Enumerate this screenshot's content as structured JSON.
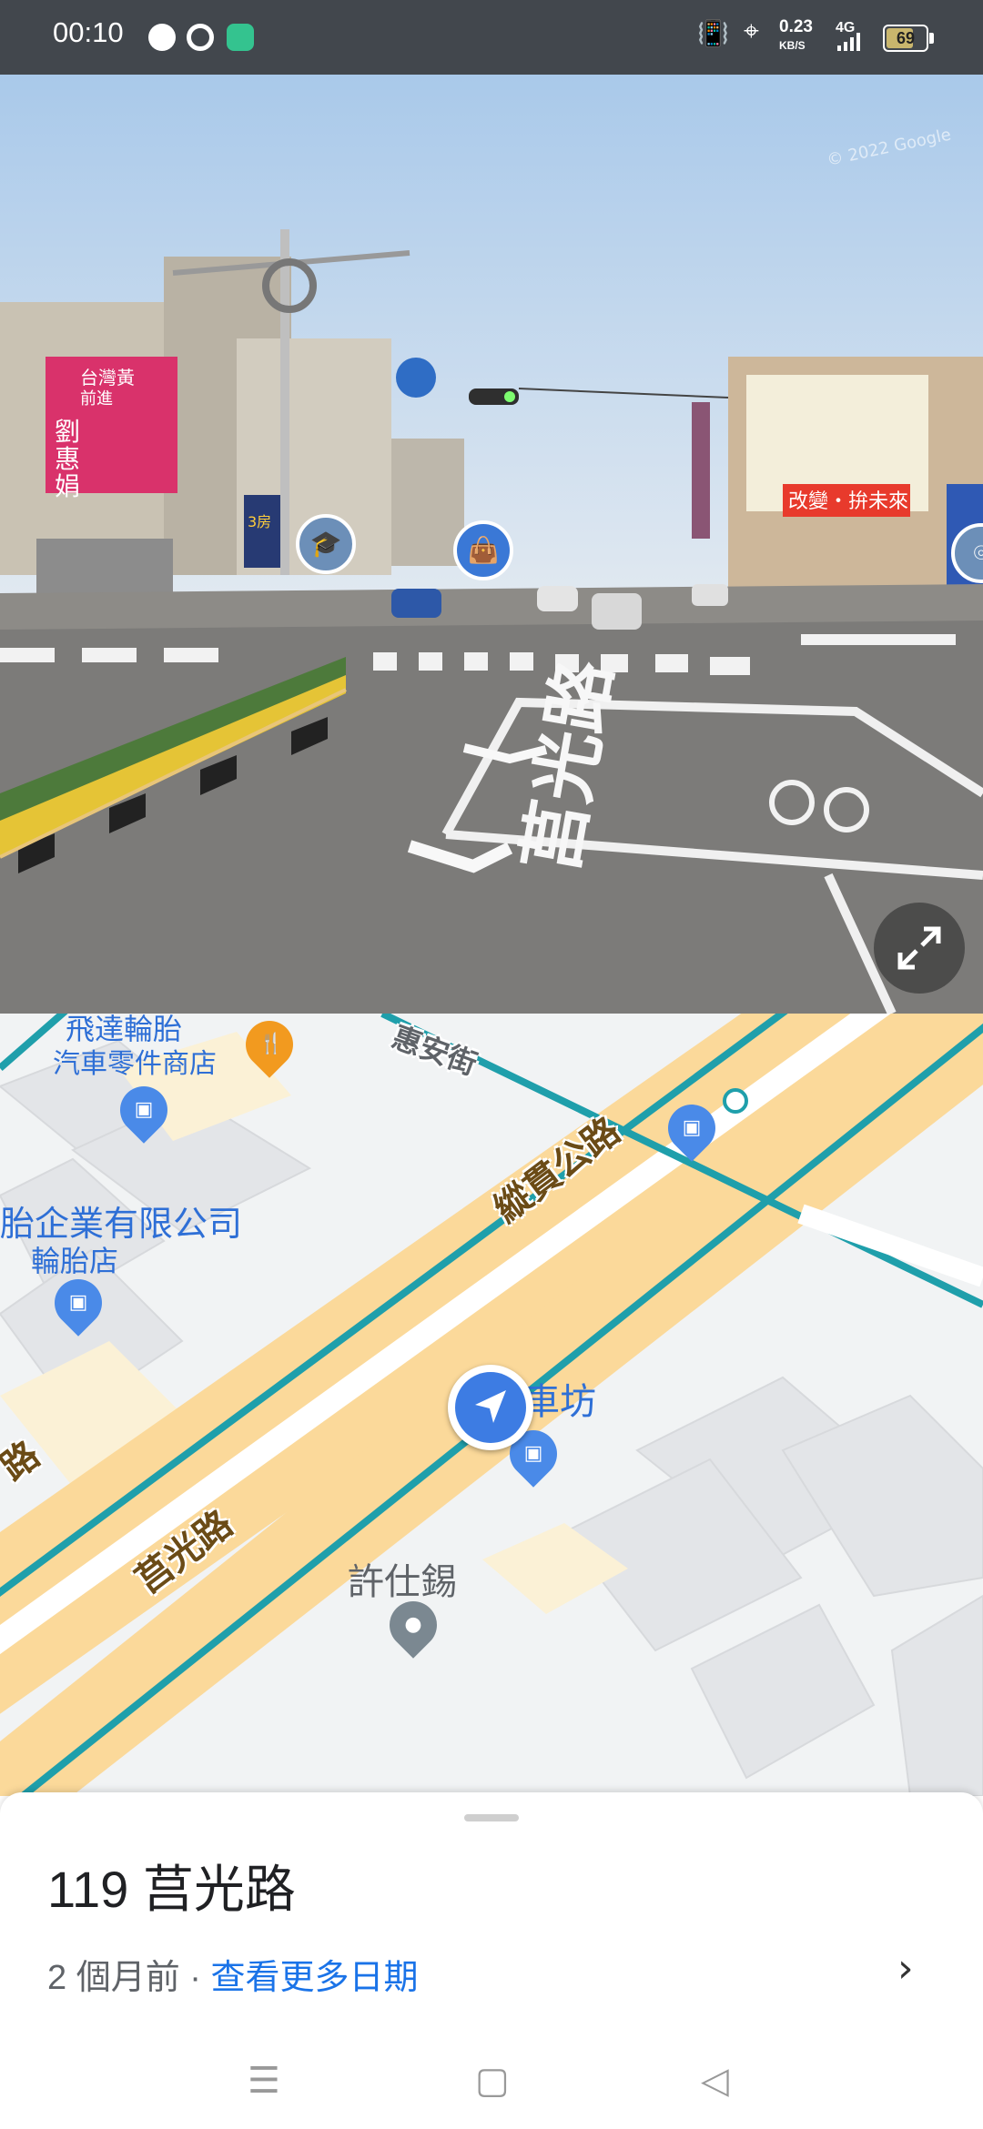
{
  "status_bar": {
    "time": "00:10",
    "data_speed": "0.23",
    "data_unit": "KB/S",
    "network": "4G",
    "battery": "69",
    "battery_level": 0.69,
    "icons": [
      "line-app-icon",
      "chrome-icon",
      "maps-app-icon",
      "vibrate-icon",
      "location-icon",
      "signal-icon",
      "battery-icon"
    ]
  },
  "street_view": {
    "watermark": "© 2022 Google",
    "billboard_left_lines": [
      "台灣黃",
      "前進",
      "劉",
      "惠",
      "娟"
    ],
    "billboard_left_tag": "3房",
    "billboard_right": "改變・拚未來",
    "road_text": "莒光路",
    "expand_icon": "expand-icon"
  },
  "map": {
    "labels": {
      "shop1_name": "飛達輪胎",
      "shop1_category": "汽車零件商店",
      "street_huian": "惠安街",
      "road_zongguan": "縱貫公路",
      "company_name": "胎企業有限公司",
      "company_category": "輪胎店",
      "poi_richu": "日出車坊",
      "road_juguang": "莒光路",
      "road_juguang_edge": "路",
      "poi_xushixi": "許仕錫"
    },
    "colors": {
      "main_road": "#fbd99a",
      "transit_line": "#1f9fab",
      "pin_blue": "#4a8ae8",
      "pin_orange": "#f29a1f"
    }
  },
  "sheet": {
    "title": "119 莒光路",
    "date": "2 個月前",
    "separator": " · ",
    "more_dates": "查看更多日期",
    "chevron": "›"
  },
  "nav": {
    "menu": "☰",
    "home": "▢",
    "back": "◁"
  }
}
